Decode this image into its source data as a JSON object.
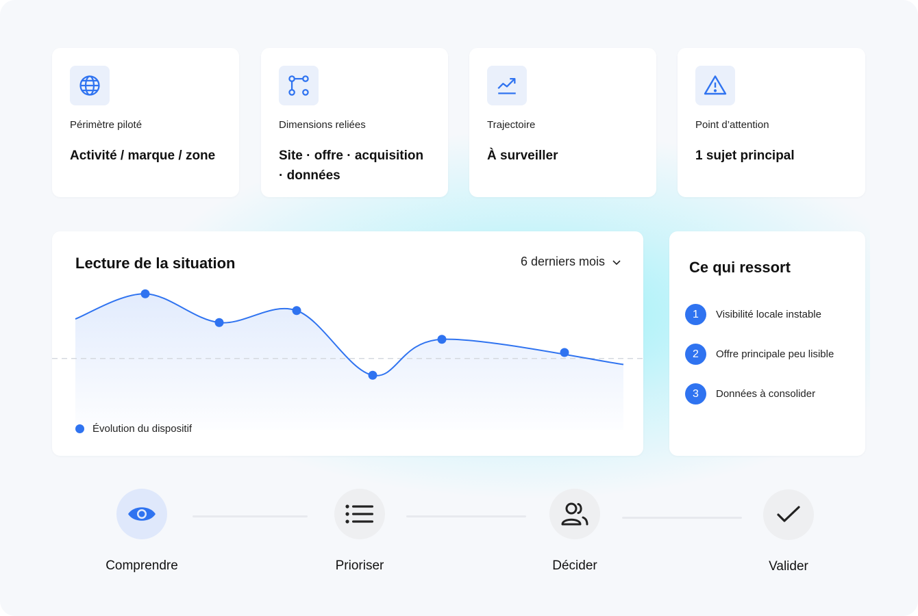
{
  "stats": [
    {
      "icon": "globe-icon",
      "label": "Périmètre piloté",
      "value": "Activité / marque / zone"
    },
    {
      "icon": "network-icon",
      "label": "Dimensions reliées",
      "value": "Site · offre · acquisition · données"
    },
    {
      "icon": "trend-up-icon",
      "label": "Trajectoire",
      "value": "À surveiller"
    },
    {
      "icon": "warning-icon",
      "label": "Point d’attention",
      "value": "1 sujet principal"
    }
  ],
  "situation": {
    "title": "Lecture de la situation",
    "period": "6 derniers mois",
    "legend": "Évolution du dispositif"
  },
  "chart_data": {
    "type": "line",
    "series": [
      {
        "name": "Évolution du dispositif",
        "values": [
          64,
          85,
          61,
          71,
          17,
          47,
          26
        ]
      }
    ],
    "reference": 31,
    "ylim": [
      -40,
      120
    ],
    "grid": false
  },
  "highlights": {
    "title": "Ce qui ressort",
    "items": [
      {
        "number": "1",
        "text": "Visibilité locale instable"
      },
      {
        "number": "2",
        "text": "Offre principale peu lisible"
      },
      {
        "number": "3",
        "text": "Données à consolider"
      }
    ]
  },
  "steps": [
    {
      "icon": "eye-icon",
      "label": "Comprendre",
      "active": true
    },
    {
      "icon": "list-icon",
      "label": "Prioriser",
      "active": false
    },
    {
      "icon": "users-icon",
      "label": "Décider",
      "active": false
    },
    {
      "icon": "check-icon",
      "label": "Valider",
      "active": false
    }
  ],
  "colors": {
    "accent": "#2f73f0",
    "background": "#f6f8fb",
    "glow": "#78eef6"
  }
}
